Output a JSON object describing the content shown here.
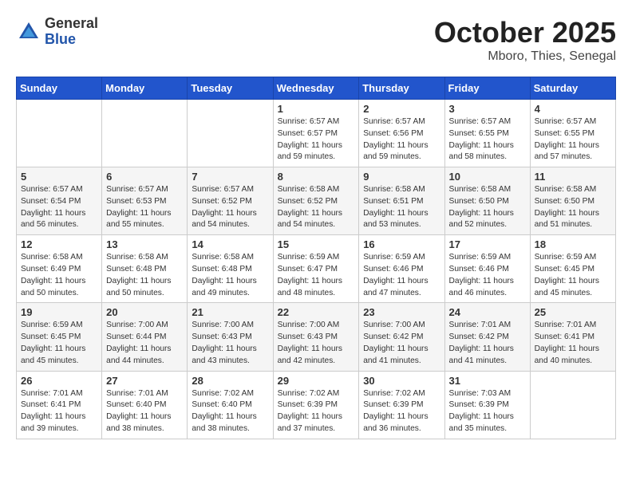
{
  "header": {
    "logo_general": "General",
    "logo_blue": "Blue",
    "month_year": "October 2025",
    "location": "Mboro, Thies, Senegal"
  },
  "weekdays": [
    "Sunday",
    "Monday",
    "Tuesday",
    "Wednesday",
    "Thursday",
    "Friday",
    "Saturday"
  ],
  "weeks": [
    [
      {
        "day": "",
        "sunrise": "",
        "sunset": "",
        "daylight": ""
      },
      {
        "day": "",
        "sunrise": "",
        "sunset": "",
        "daylight": ""
      },
      {
        "day": "",
        "sunrise": "",
        "sunset": "",
        "daylight": ""
      },
      {
        "day": "1",
        "sunrise": "Sunrise: 6:57 AM",
        "sunset": "Sunset: 6:57 PM",
        "daylight": "Daylight: 11 hours and 59 minutes."
      },
      {
        "day": "2",
        "sunrise": "Sunrise: 6:57 AM",
        "sunset": "Sunset: 6:56 PM",
        "daylight": "Daylight: 11 hours and 59 minutes."
      },
      {
        "day": "3",
        "sunrise": "Sunrise: 6:57 AM",
        "sunset": "Sunset: 6:55 PM",
        "daylight": "Daylight: 11 hours and 58 minutes."
      },
      {
        "day": "4",
        "sunrise": "Sunrise: 6:57 AM",
        "sunset": "Sunset: 6:55 PM",
        "daylight": "Daylight: 11 hours and 57 minutes."
      }
    ],
    [
      {
        "day": "5",
        "sunrise": "Sunrise: 6:57 AM",
        "sunset": "Sunset: 6:54 PM",
        "daylight": "Daylight: 11 hours and 56 minutes."
      },
      {
        "day": "6",
        "sunrise": "Sunrise: 6:57 AM",
        "sunset": "Sunset: 6:53 PM",
        "daylight": "Daylight: 11 hours and 55 minutes."
      },
      {
        "day": "7",
        "sunrise": "Sunrise: 6:57 AM",
        "sunset": "Sunset: 6:52 PM",
        "daylight": "Daylight: 11 hours and 54 minutes."
      },
      {
        "day": "8",
        "sunrise": "Sunrise: 6:58 AM",
        "sunset": "Sunset: 6:52 PM",
        "daylight": "Daylight: 11 hours and 54 minutes."
      },
      {
        "day": "9",
        "sunrise": "Sunrise: 6:58 AM",
        "sunset": "Sunset: 6:51 PM",
        "daylight": "Daylight: 11 hours and 53 minutes."
      },
      {
        "day": "10",
        "sunrise": "Sunrise: 6:58 AM",
        "sunset": "Sunset: 6:50 PM",
        "daylight": "Daylight: 11 hours and 52 minutes."
      },
      {
        "day": "11",
        "sunrise": "Sunrise: 6:58 AM",
        "sunset": "Sunset: 6:50 PM",
        "daylight": "Daylight: 11 hours and 51 minutes."
      }
    ],
    [
      {
        "day": "12",
        "sunrise": "Sunrise: 6:58 AM",
        "sunset": "Sunset: 6:49 PM",
        "daylight": "Daylight: 11 hours and 50 minutes."
      },
      {
        "day": "13",
        "sunrise": "Sunrise: 6:58 AM",
        "sunset": "Sunset: 6:48 PM",
        "daylight": "Daylight: 11 hours and 50 minutes."
      },
      {
        "day": "14",
        "sunrise": "Sunrise: 6:58 AM",
        "sunset": "Sunset: 6:48 PM",
        "daylight": "Daylight: 11 hours and 49 minutes."
      },
      {
        "day": "15",
        "sunrise": "Sunrise: 6:59 AM",
        "sunset": "Sunset: 6:47 PM",
        "daylight": "Daylight: 11 hours and 48 minutes."
      },
      {
        "day": "16",
        "sunrise": "Sunrise: 6:59 AM",
        "sunset": "Sunset: 6:46 PM",
        "daylight": "Daylight: 11 hours and 47 minutes."
      },
      {
        "day": "17",
        "sunrise": "Sunrise: 6:59 AM",
        "sunset": "Sunset: 6:46 PM",
        "daylight": "Daylight: 11 hours and 46 minutes."
      },
      {
        "day": "18",
        "sunrise": "Sunrise: 6:59 AM",
        "sunset": "Sunset: 6:45 PM",
        "daylight": "Daylight: 11 hours and 45 minutes."
      }
    ],
    [
      {
        "day": "19",
        "sunrise": "Sunrise: 6:59 AM",
        "sunset": "Sunset: 6:45 PM",
        "daylight": "Daylight: 11 hours and 45 minutes."
      },
      {
        "day": "20",
        "sunrise": "Sunrise: 7:00 AM",
        "sunset": "Sunset: 6:44 PM",
        "daylight": "Daylight: 11 hours and 44 minutes."
      },
      {
        "day": "21",
        "sunrise": "Sunrise: 7:00 AM",
        "sunset": "Sunset: 6:43 PM",
        "daylight": "Daylight: 11 hours and 43 minutes."
      },
      {
        "day": "22",
        "sunrise": "Sunrise: 7:00 AM",
        "sunset": "Sunset: 6:43 PM",
        "daylight": "Daylight: 11 hours and 42 minutes."
      },
      {
        "day": "23",
        "sunrise": "Sunrise: 7:00 AM",
        "sunset": "Sunset: 6:42 PM",
        "daylight": "Daylight: 11 hours and 41 minutes."
      },
      {
        "day": "24",
        "sunrise": "Sunrise: 7:01 AM",
        "sunset": "Sunset: 6:42 PM",
        "daylight": "Daylight: 11 hours and 41 minutes."
      },
      {
        "day": "25",
        "sunrise": "Sunrise: 7:01 AM",
        "sunset": "Sunset: 6:41 PM",
        "daylight": "Daylight: 11 hours and 40 minutes."
      }
    ],
    [
      {
        "day": "26",
        "sunrise": "Sunrise: 7:01 AM",
        "sunset": "Sunset: 6:41 PM",
        "daylight": "Daylight: 11 hours and 39 minutes."
      },
      {
        "day": "27",
        "sunrise": "Sunrise: 7:01 AM",
        "sunset": "Sunset: 6:40 PM",
        "daylight": "Daylight: 11 hours and 38 minutes."
      },
      {
        "day": "28",
        "sunrise": "Sunrise: 7:02 AM",
        "sunset": "Sunset: 6:40 PM",
        "daylight": "Daylight: 11 hours and 38 minutes."
      },
      {
        "day": "29",
        "sunrise": "Sunrise: 7:02 AM",
        "sunset": "Sunset: 6:39 PM",
        "daylight": "Daylight: 11 hours and 37 minutes."
      },
      {
        "day": "30",
        "sunrise": "Sunrise: 7:02 AM",
        "sunset": "Sunset: 6:39 PM",
        "daylight": "Daylight: 11 hours and 36 minutes."
      },
      {
        "day": "31",
        "sunrise": "Sunrise: 7:03 AM",
        "sunset": "Sunset: 6:39 PM",
        "daylight": "Daylight: 11 hours and 35 minutes."
      },
      {
        "day": "",
        "sunrise": "",
        "sunset": "",
        "daylight": ""
      }
    ]
  ]
}
